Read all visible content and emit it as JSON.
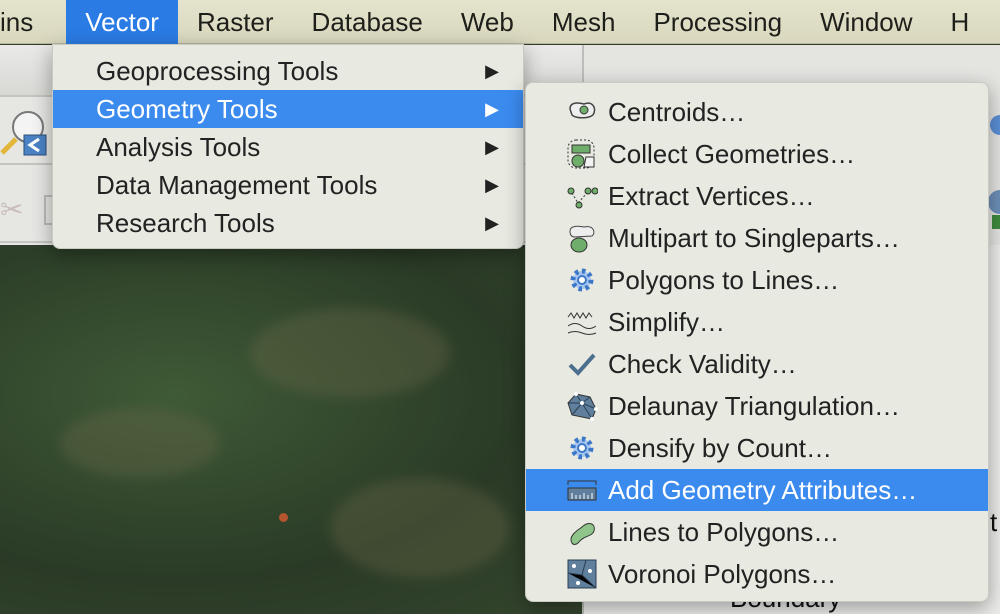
{
  "menubar": {
    "items": [
      "ins",
      "Vector",
      "Raster",
      "Database",
      "Web",
      "Mesh",
      "Processing",
      "Window",
      "H"
    ],
    "active": "Vector"
  },
  "vector_menu": {
    "items": [
      {
        "label": "Geoprocessing Tools",
        "submenu": true
      },
      {
        "label": "Geometry Tools",
        "submenu": true,
        "highlighted": true
      },
      {
        "label": "Analysis Tools",
        "submenu": true
      },
      {
        "label": "Data Management Tools",
        "submenu": true
      },
      {
        "label": "Research Tools",
        "submenu": true
      }
    ]
  },
  "geometry_tools_menu": {
    "items": [
      {
        "label": "Centroids…",
        "icon": "centroids-icon"
      },
      {
        "label": "Collect Geometries…",
        "icon": "collect-geometries-icon"
      },
      {
        "label": "Extract Vertices…",
        "icon": "extract-vertices-icon"
      },
      {
        "label": "Multipart to Singleparts…",
        "icon": "multipart-icon"
      },
      {
        "label": "Polygons to Lines…",
        "icon": "gear-icon"
      },
      {
        "label": "Simplify…",
        "icon": "simplify-icon"
      },
      {
        "label": "Check Validity…",
        "icon": "checkmark-icon"
      },
      {
        "label": "Delaunay Triangulation…",
        "icon": "delaunay-icon"
      },
      {
        "label": "Densify by Count…",
        "icon": "gear-icon"
      },
      {
        "label": "Add Geometry Attributes…",
        "icon": "ruler-icon",
        "highlighted": true
      },
      {
        "label": "Lines to Polygons…",
        "icon": "lines-to-polygons-icon"
      },
      {
        "label": "Voronoi Polygons…",
        "icon": "voronoi-icon"
      }
    ]
  },
  "background": {
    "layer_partial": "Boundary",
    "panel_partial": "t"
  },
  "colors": {
    "highlight": "#3b8bef",
    "menubar_active": "#2a7be4",
    "menu_bg": "#e8e9e1"
  }
}
